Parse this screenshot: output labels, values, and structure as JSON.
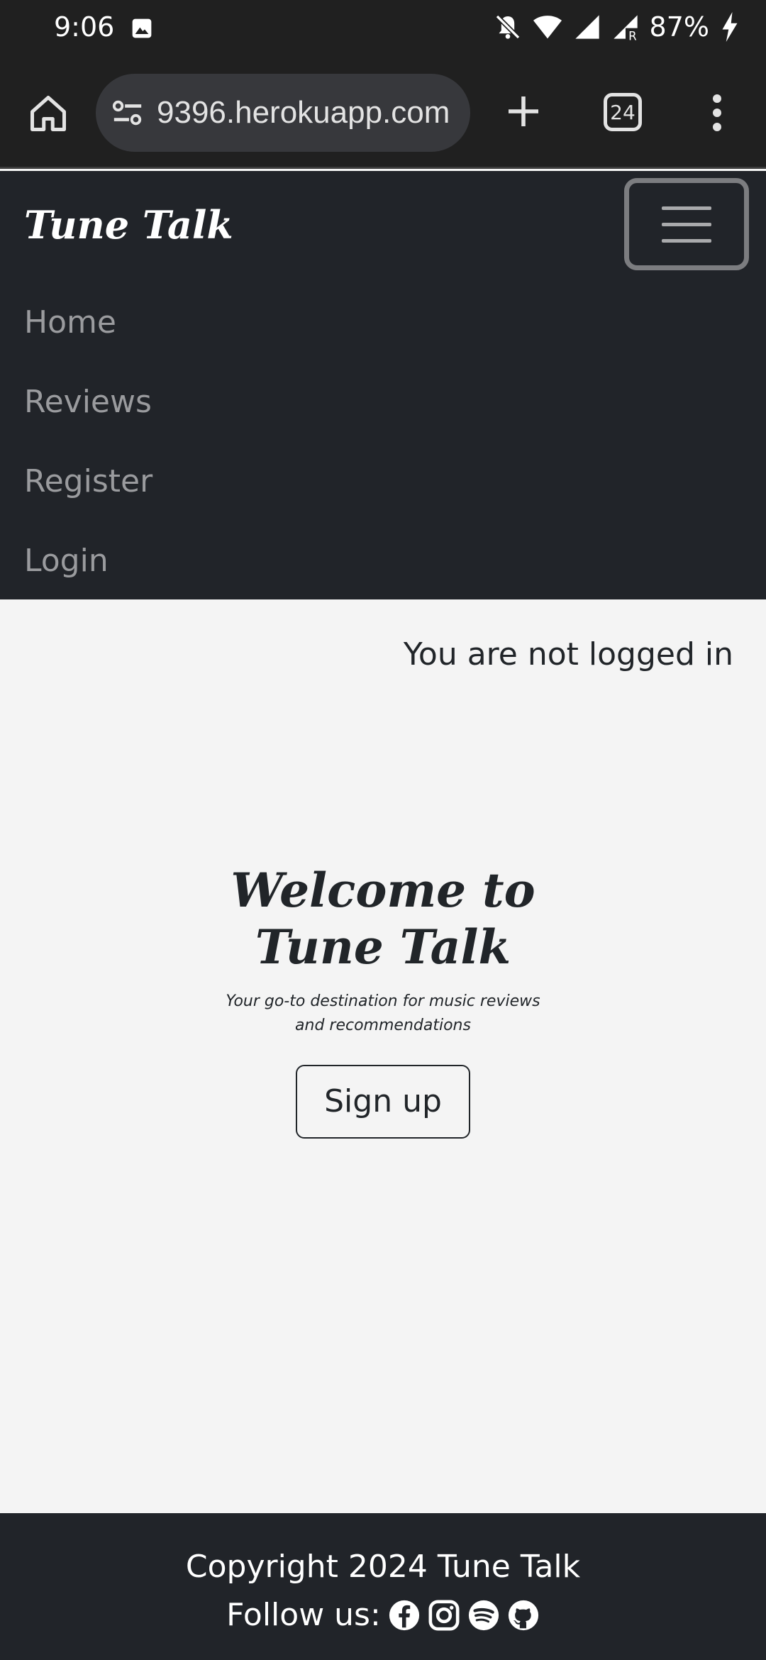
{
  "status_bar": {
    "time": "9:06",
    "battery": "87%",
    "icons": [
      "gallery-icon",
      "bell-off-icon",
      "wifi-icon",
      "signal-icon",
      "signal-roaming-icon",
      "charging-icon"
    ]
  },
  "browser": {
    "url": "9396.herokuapp.com",
    "tab_count": "24",
    "icons": [
      "home-icon",
      "site-info-icon",
      "plus-icon",
      "tab-switcher-icon",
      "more-vert-icon"
    ]
  },
  "navbar": {
    "brand": "Tune Talk",
    "items": [
      {
        "label": "Home"
      },
      {
        "label": "Reviews"
      },
      {
        "label": "Register"
      },
      {
        "label": "Login"
      }
    ]
  },
  "main": {
    "login_status": "You are not logged in",
    "hero": {
      "title_line1": "Welcome to",
      "title_line2": "Tune Talk",
      "subtitle_line1": "Your go-to destination for music reviews",
      "subtitle_line2": "and recommendations",
      "signup_label": "Sign up"
    }
  },
  "footer": {
    "copyright": "Copyright 2024 Tune Talk",
    "follow_label": "Follow us:",
    "social_icons": [
      "facebook-icon",
      "instagram-icon",
      "spotify-icon",
      "github-icon"
    ]
  }
}
